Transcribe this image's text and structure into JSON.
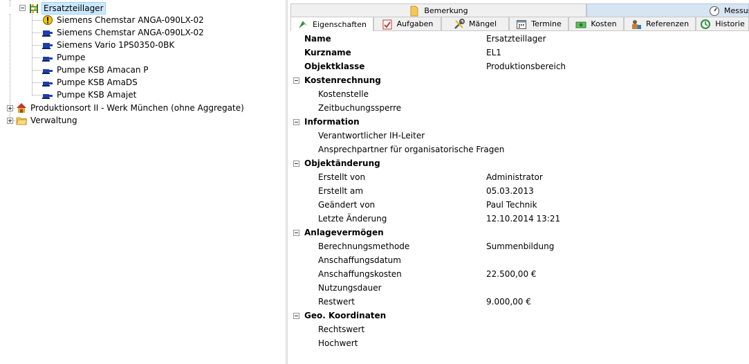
{
  "tree": {
    "root_label": "Ersatzteillager",
    "children": [
      "Siemens Chemstar ANGA-090LX-02",
      "Siemens Chemstar ANGA-090LX-02",
      "Siemens Vario 1PS0350-0BK",
      "Pumpe",
      "Pumpe KSB Amacan P",
      "Pumpe KSB AmaDS",
      "Pumpe KSB Amajet"
    ],
    "siblings": [
      "Produktionsort II - Werk München (ohne Aggregate)",
      "Verwaltung"
    ]
  },
  "tabs_top": {
    "bemerkung": "Bemerkung",
    "messung": "Messun"
  },
  "tabs": {
    "eigenschaften": "Eigenschaften",
    "aufgaben": "Aufgaben",
    "maengel": "Mängel",
    "termine": "Termine",
    "kosten": "Kosten",
    "referenzen": "Referenzen",
    "historie": "Historie"
  },
  "properties": {
    "name_label": "Name",
    "name_value": "Ersatzteillager",
    "kurzname_label": "Kurzname",
    "kurzname_value": "EL1",
    "objektklasse_label": "Objektklasse",
    "objektklasse_value": "Produktionsbereich",
    "cat_kostenrechnung": "Kostenrechnung",
    "kostenstelle": "Kostenstelle",
    "zeitbuchungssperre": "Zeitbuchungssperre",
    "cat_information": "Information",
    "ih_leiter": "Verantwortlicher IH-Leiter",
    "ansprechpartner": "Ansprechpartner für organisatorische Fragen",
    "cat_objektaenderung": "Objektänderung",
    "erstellt_von_label": "Erstellt von",
    "erstellt_von_value": "Administrator",
    "erstellt_am_label": "Erstellt am",
    "erstellt_am_value": "05.03.2013",
    "geaendert_von_label": "Geändert von",
    "geaendert_von_value": "Paul Technik",
    "letzte_aenderung_label": "Letzte Änderung",
    "letzte_aenderung_value": "12.10.2014 13:21",
    "cat_anlagevermoegen": "Anlagevermögen",
    "berechnungsmethode_label": "Berechnungsmethode",
    "berechnungsmethode_value": "Summenbildung",
    "anschaffungsdatum": "Anschaffungsdatum",
    "anschaffungskosten_label": "Anschaffungskosten",
    "anschaffungskosten_value": "22.500,00 €",
    "nutzungsdauer": "Nutzungsdauer",
    "restwert_label": "Restwert",
    "restwert_value": "9.000,00 €",
    "cat_geo": "Geo. Koordinaten",
    "rechtswert": "Rechtswert",
    "hochwert": "Hochwert"
  },
  "colors": {
    "selection_bg": "#cce8ff",
    "tab_inactive_bg": "#f0f0f0",
    "tab_messung_bg": "#d7e4f2"
  }
}
